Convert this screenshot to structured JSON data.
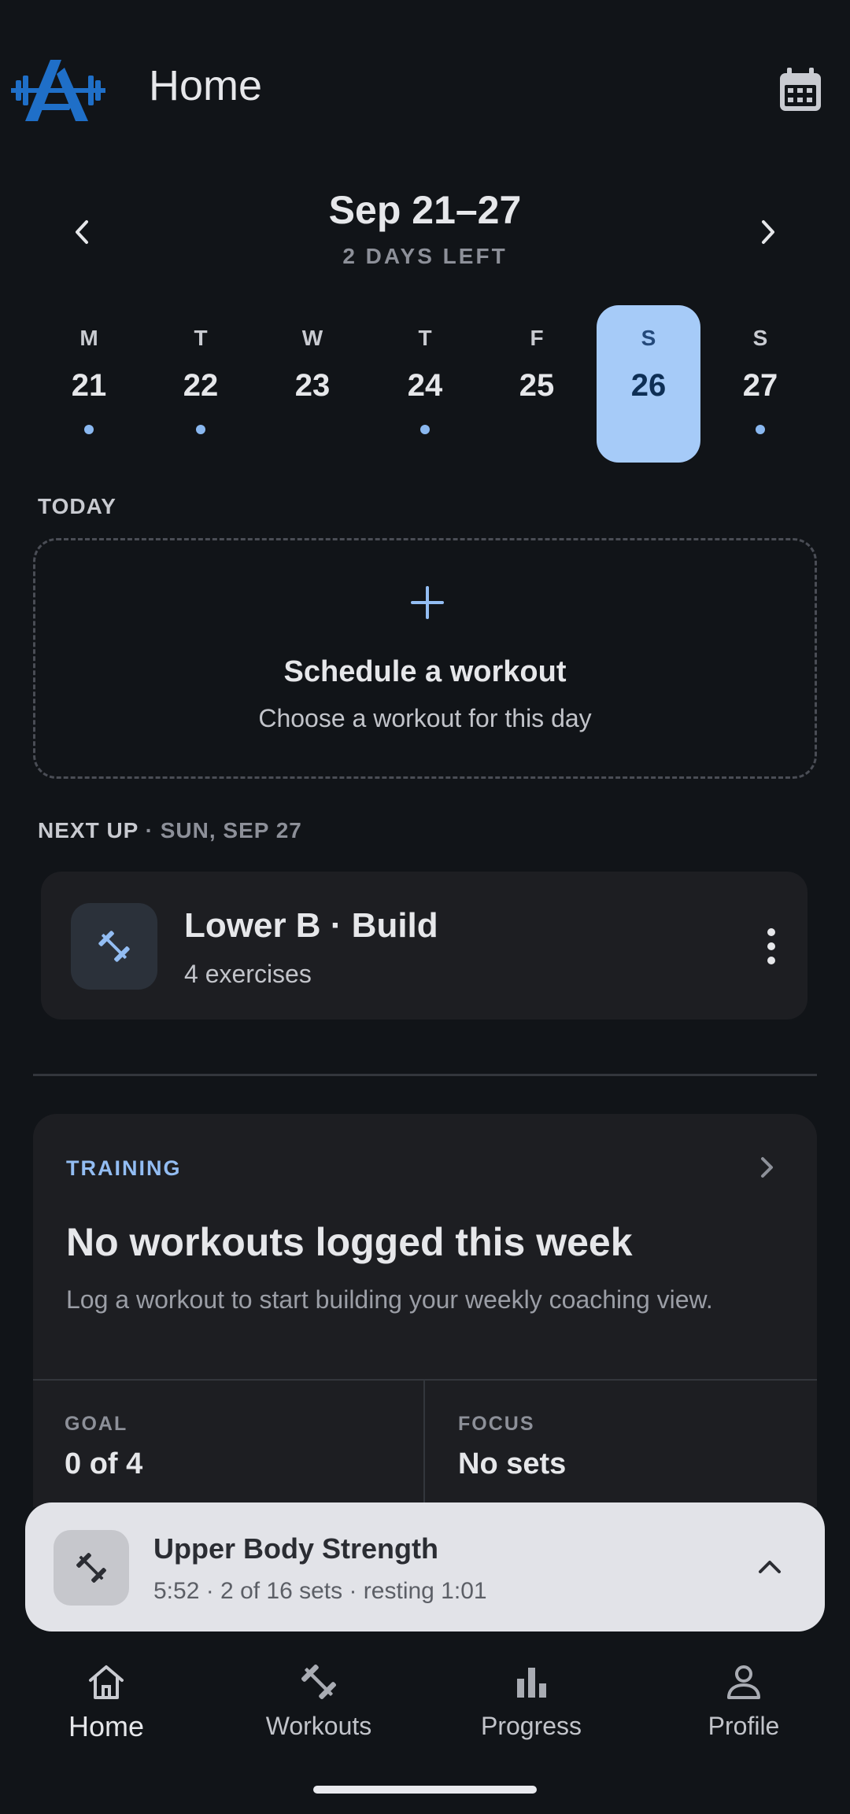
{
  "header": {
    "title": "Home",
    "logo_icon": "barbell-logo-icon",
    "calendar_icon": "calendar-icon"
  },
  "week": {
    "range": "Sep 21–27",
    "days_left": "2 DAYS LEFT",
    "days": [
      {
        "name": "M",
        "num": "21",
        "has_workout": true,
        "selected": false
      },
      {
        "name": "T",
        "num": "22",
        "has_workout": true,
        "selected": false
      },
      {
        "name": "W",
        "num": "23",
        "has_workout": false,
        "selected": false
      },
      {
        "name": "T",
        "num": "24",
        "has_workout": true,
        "selected": false
      },
      {
        "name": "F",
        "num": "25",
        "has_workout": false,
        "selected": false
      },
      {
        "name": "S",
        "num": "26",
        "has_workout": false,
        "selected": true
      },
      {
        "name": "S",
        "num": "27",
        "has_workout": true,
        "selected": false
      }
    ]
  },
  "today": {
    "label": "TODAY",
    "schedule_title": "Schedule a workout",
    "schedule_sub": "Choose a workout for this day"
  },
  "next_up": {
    "label": "NEXT UP",
    "separator": "·",
    "date": "SUN, SEP 27",
    "workout_title": "Lower B · Build",
    "workout_sub": "4 exercises"
  },
  "training": {
    "label": "TRAINING",
    "title": "No workouts logged this week",
    "description": "Log a workout to start building your weekly coaching view.",
    "goal_label": "GOAL",
    "goal_value": "0 of 4",
    "focus_label": "FOCUS",
    "focus_value": "No sets"
  },
  "active_workout": {
    "title": "Upper Body Strength",
    "subtitle": "5:52 · 2 of 16 sets · resting 1:01"
  },
  "nav": {
    "home": "Home",
    "workouts": "Workouts",
    "progress": "Progress",
    "profile": "Profile"
  },
  "colors": {
    "background": "#111418",
    "accent": "#a6cbf8",
    "card": "#1d1e22",
    "logo": "#1f6fc8"
  }
}
